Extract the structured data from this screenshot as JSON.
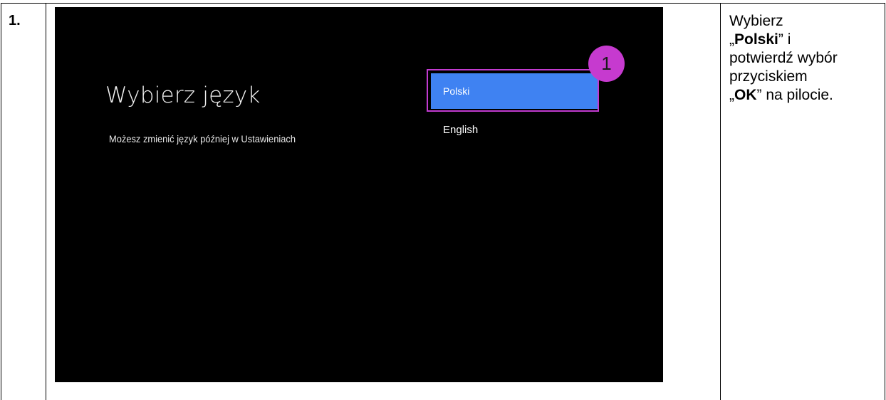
{
  "step": {
    "number": "1."
  },
  "tv": {
    "title": "Wybierz język",
    "subtitle": "Możesz zmienić  język później w Ustawieniach",
    "options": [
      {
        "label": "Polski",
        "selected": true
      },
      {
        "label": "English",
        "selected": false
      }
    ],
    "marker": "1",
    "colors": {
      "selected_bg": "#3f82f2",
      "highlight": "#c23bd0",
      "screen_bg": "#000000"
    }
  },
  "instruction": {
    "line1": "Wybierz",
    "open_quote_1": "„",
    "bold1": "Polski",
    "close_1": "” i",
    "line3": "potwierdź wybór",
    "line4": "przyciskiem",
    "open_quote_2": "„",
    "bold2": "OK",
    "close_2": "” na pilocie."
  }
}
